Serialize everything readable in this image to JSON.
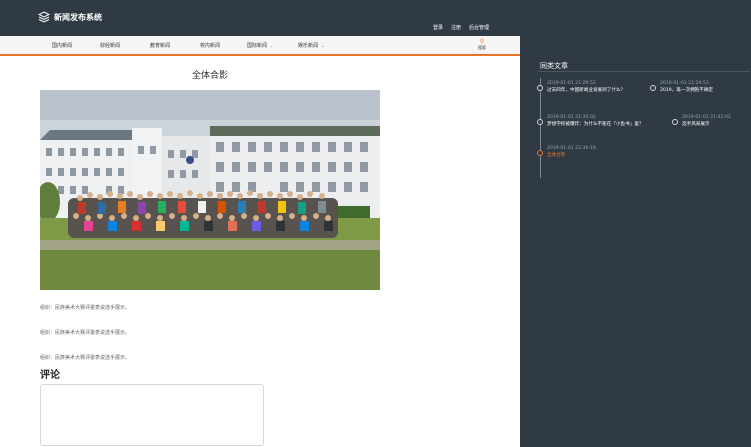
{
  "header": {
    "site_name": "新闻发布系统",
    "links": [
      "登录",
      "注册",
      "后台管理"
    ]
  },
  "nav": {
    "items": [
      "国内新闻",
      "财经新闻",
      "教育新闻",
      "校内新闻",
      "国际新闻",
      "娱乐新闻"
    ],
    "search_label": "搜索"
  },
  "article": {
    "title": "全体合影",
    "captions": [
      "组织：民族美术大赛评委表说选手展示。",
      "组织：民族美术大赛评委表说选手展示。",
      "组织：民族美术大赛评委表说选手展示。"
    ]
  },
  "comments": {
    "heading": "评论"
  },
  "sidebar": {
    "title": "同类文章",
    "items": [
      {
        "date": "2019-01-01 21:29:52",
        "title": "过去四年，中国新闻业发展到了什么？"
      },
      {
        "date": "2019-01-01 21:29:53",
        "title": "2019，再一次拥抱不确定"
      },
      {
        "date": "2019-01-01 21:30:02",
        "title": "梦想学校被爆炸：为什么不能在「小鱼书」里？"
      },
      {
        "date": "2019-01-01 21:41:02",
        "title": "选手风采展示"
      },
      {
        "date": "2019-01-01 22:36:19",
        "title": "全体合影"
      }
    ],
    "accent_color": "#e8742c"
  }
}
